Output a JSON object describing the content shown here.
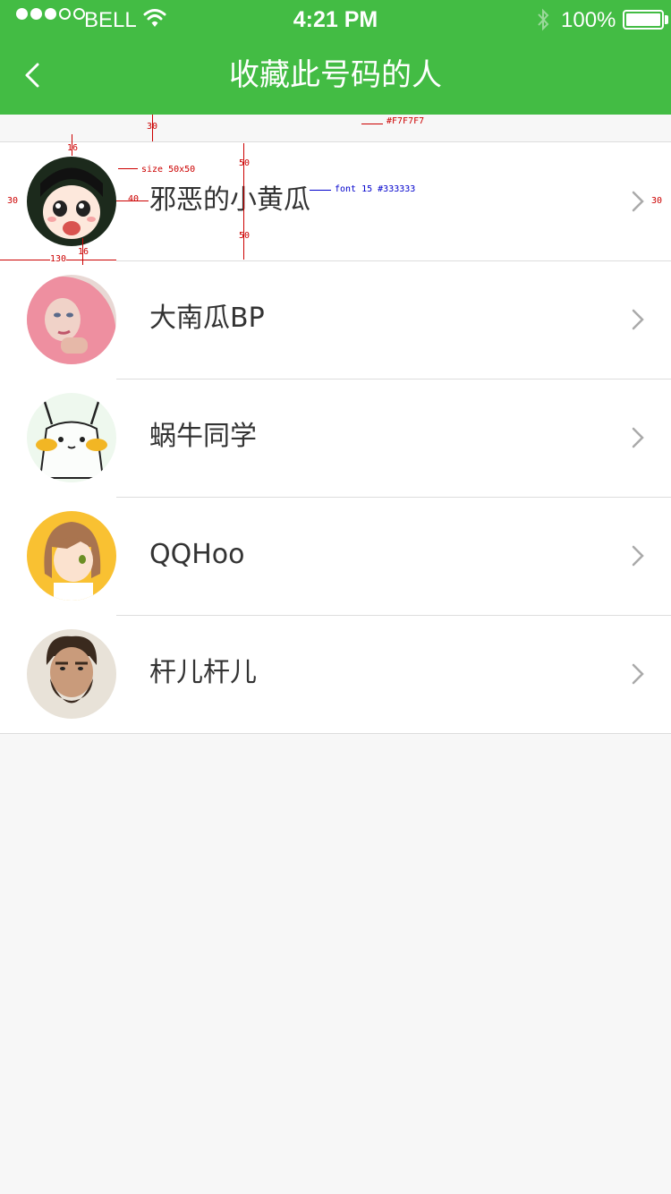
{
  "status_bar": {
    "carrier": "BELL",
    "time": "4:21 PM",
    "battery": "100%"
  },
  "nav": {
    "title": "收藏此号码的人"
  },
  "people": [
    {
      "name": "邪恶的小黄瓜",
      "avatar_icon": "anime-girl-avatar-icon"
    },
    {
      "name": "大南瓜BP",
      "avatar_icon": "pink-hair-avatar-icon"
    },
    {
      "name": "蜗牛同学",
      "avatar_icon": "pikachu-avatar-icon"
    },
    {
      "name": "QQHoo",
      "avatar_icon": "orange-hair-girl-avatar-icon"
    },
    {
      "name": "杆儿杆儿",
      "avatar_icon": "bearded-man-avatar-icon"
    }
  ],
  "annotations": {
    "top_gap": "30",
    "bg_color": "#F7F7F7",
    "avatar_top": "16",
    "avatar_size": "size 50x50",
    "row_top": "50",
    "font": "font 15 #333333",
    "left_pad": "30",
    "text_gap": "40",
    "right_pad": "30",
    "row_bottom": "50",
    "avatar_bottom": "16",
    "avatar_col": "130"
  },
  "colors": {
    "header": "#43BC44",
    "background": "#F7F7F7",
    "text": "#333333",
    "divider": "#DDDDDD",
    "chevron": "#AAAAAA"
  }
}
